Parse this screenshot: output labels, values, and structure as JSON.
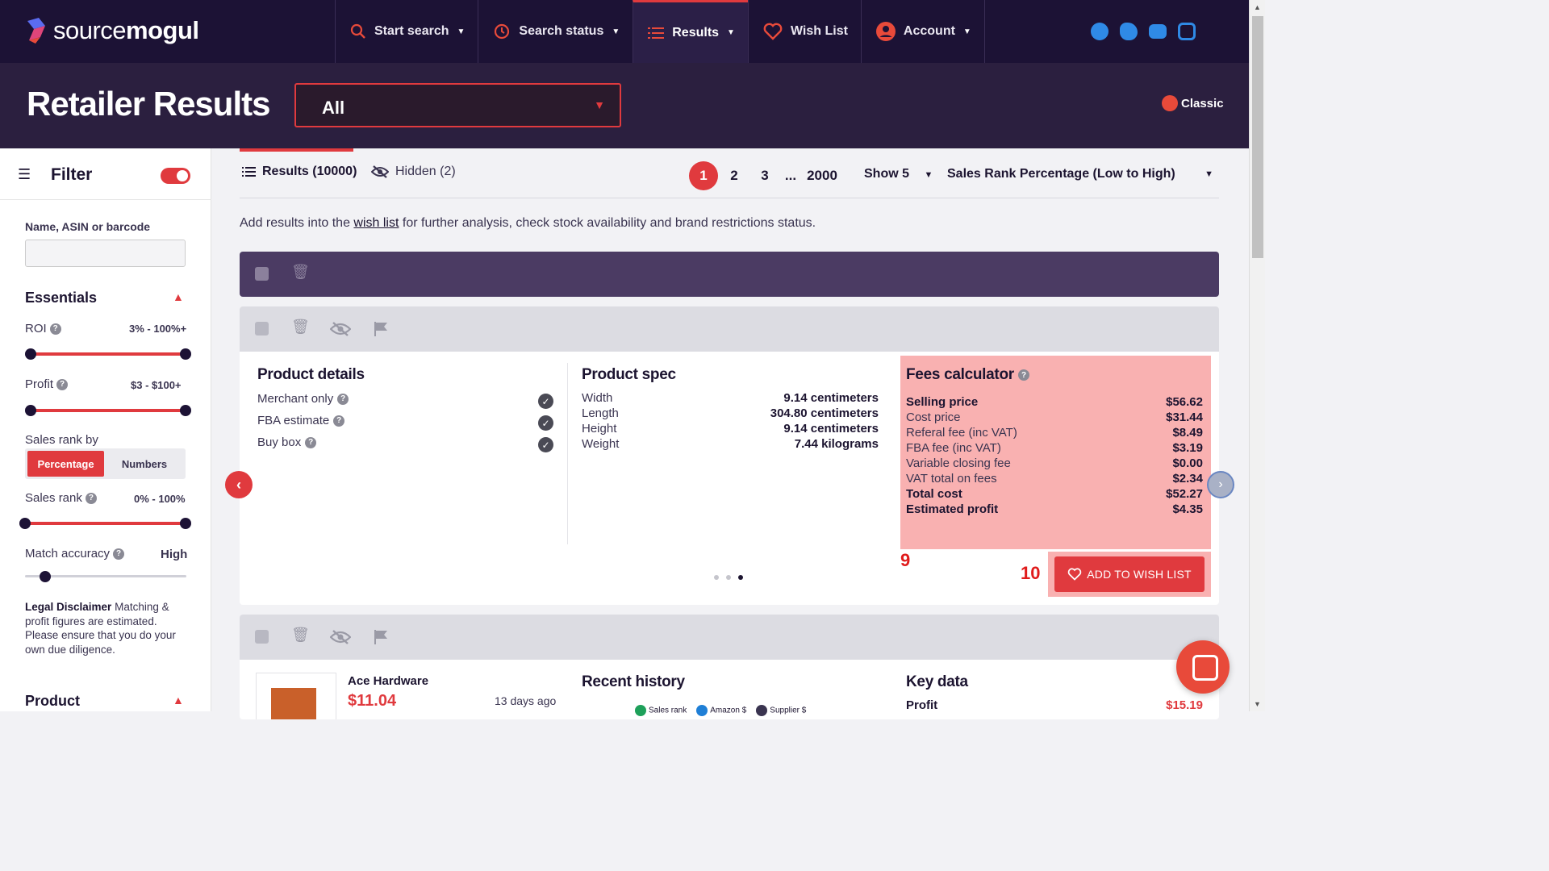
{
  "brand": {
    "name_light": "source",
    "name_bold": "mogul"
  },
  "nav": {
    "items": [
      {
        "label": "Start search",
        "icon": "search-icon",
        "has_dropdown": true,
        "active": false
      },
      {
        "label": "Search status",
        "icon": "history-icon",
        "has_dropdown": true,
        "active": false
      },
      {
        "label": "Results",
        "icon": "list-icon",
        "has_dropdown": true,
        "active": true
      },
      {
        "label": "Wish List",
        "icon": "heart-icon",
        "has_dropdown": false,
        "active": false
      },
      {
        "label": "Account",
        "icon": "user-icon",
        "has_dropdown": true,
        "active": false
      }
    ],
    "social": [
      "facebook-icon",
      "twitter-icon",
      "youtube-icon",
      "instagram-icon"
    ]
  },
  "header": {
    "title": "Retailer Results",
    "retailer_value": "All",
    "classic_label": "Classic"
  },
  "sidebar": {
    "filter_label": "Filter",
    "filter_enabled": true,
    "search_label": "Name, ASIN or barcode",
    "search_value": "",
    "essentials_label": "Essentials",
    "roi": {
      "label": "ROI",
      "value": "3% - 100%+",
      "min": 3,
      "max": 100
    },
    "profit": {
      "label": "Profit",
      "value": "$3 - $100+",
      "min": 3,
      "max": 100
    },
    "sales_rank_by": {
      "label": "Sales rank by",
      "options": [
        "Percentage",
        "Numbers"
      ],
      "selected": "Percentage"
    },
    "sales_rank": {
      "label": "Sales rank",
      "value": "0% - 100%",
      "min": 0,
      "max": 100
    },
    "match_accuracy": {
      "label": "Match accuracy",
      "value": "High"
    },
    "disclaimer_title": "Legal Disclaimer",
    "disclaimer_text": "Matching & profit figures are estimated. Please ensure that you do your own due diligence.",
    "product_label": "Product"
  },
  "tabs": {
    "results": "Results (10000)",
    "hidden": "Hidden (2)"
  },
  "pagination": {
    "pages": [
      "1",
      "2",
      "3",
      "...",
      "2000"
    ],
    "current": "1",
    "show": "Show 5",
    "sort": "Sales Rank Percentage (Low to High)"
  },
  "hint": {
    "before": "Add results into the ",
    "link": "wish list",
    "after": " for further analysis, check stock availability and brand restrictions status."
  },
  "card1": {
    "product_details": {
      "title": "Product details",
      "rows": [
        {
          "label": "Merchant only",
          "checked": true
        },
        {
          "label": "FBA estimate",
          "checked": true
        },
        {
          "label": "Buy box",
          "checked": true
        }
      ]
    },
    "product_spec": {
      "title": "Product spec",
      "rows": [
        {
          "label": "Width",
          "value": "9.14 centimeters"
        },
        {
          "label": "Length",
          "value": "304.80 centimeters"
        },
        {
          "label": "Height",
          "value": "9.14 centimeters"
        },
        {
          "label": "Weight",
          "value": "7.44 kilograms"
        }
      ]
    },
    "fees": {
      "title": "Fees calculator",
      "rows": [
        {
          "label": "Selling price",
          "value": "$56.62",
          "bold": true
        },
        {
          "label": "Cost price",
          "value": "$31.44",
          "bold": false
        },
        {
          "label": "Referal fee (inc VAT)",
          "value": "$8.49",
          "bold": false
        },
        {
          "label": "FBA fee (inc VAT)",
          "value": "$3.19",
          "bold": false
        },
        {
          "label": "Variable closing fee",
          "value": "$0.00",
          "bold": false
        },
        {
          "label": "VAT total on fees",
          "value": "$2.34",
          "bold": false
        },
        {
          "label": "Total cost",
          "value": "$52.27",
          "bold": true
        },
        {
          "label": "Estimated profit",
          "value": "$4.35",
          "bold": true
        }
      ]
    },
    "annotation_a": "9",
    "annotation_b": "10",
    "wish_button": "ADD TO WISH LIST",
    "carousel_pages": 3,
    "carousel_current": 3
  },
  "card2": {
    "store": "Ace Hardware",
    "price": "$11.04",
    "ago": "13 days ago",
    "recent_history_title": "Recent history",
    "legend": [
      {
        "name": "Sales rank",
        "color": "#1ea05a"
      },
      {
        "name": "Amazon $",
        "color": "#1f7fd6"
      },
      {
        "name": "Supplier $",
        "color": "#3a3450"
      }
    ],
    "key_data_title": "Key data",
    "key_data_row": {
      "label": "Profit",
      "value": "$15.19"
    }
  },
  "colors": {
    "accent": "#e03a3e",
    "nav_bg": "#1c1235",
    "band_bg": "#2b1f3f",
    "fees_bg": "#f9b1b1"
  }
}
